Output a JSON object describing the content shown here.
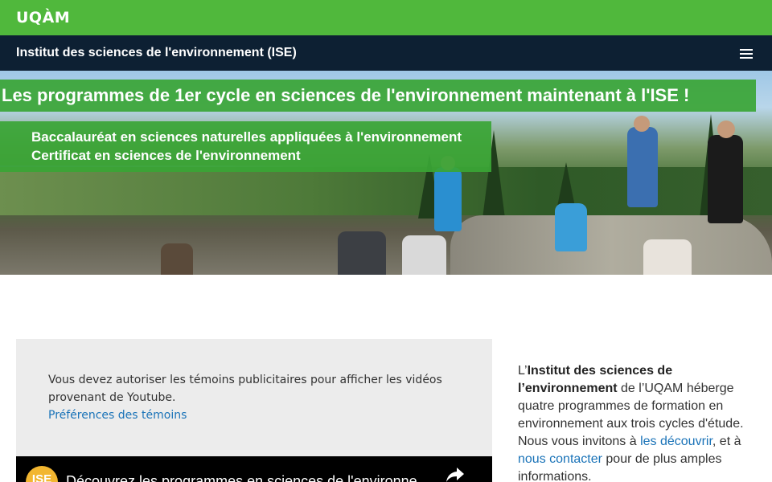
{
  "brand": {
    "logo_text": "UQÀM",
    "primary_color": "#50b83c",
    "dark_color": "#0d2033",
    "link_color": "#1a73b8"
  },
  "site": {
    "title": "Institut des sciences de l'environnement (ISE)",
    "menu_icon": "hamburger-menu-icon"
  },
  "hero": {
    "headline": "Les programmes de 1er cycle en sciences de l'environnement maintenant à l'ISE !",
    "program_1": "Baccalauréat en sciences naturelles appliquées à l'environnement",
    "program_2": "Certificat en sciences de l'environnement"
  },
  "video": {
    "consent_message": "Vous devez autoriser les témoins publicitaires pour afficher les vidéos provenant de Youtube.",
    "consent_link": "Préférences des témoins",
    "channel_avatar_text": "ISE",
    "video_title": "Découvrez les programmes en sciences de l'environne",
    "share_icon": "share-arrow-icon"
  },
  "intro": {
    "prefix": "L’",
    "institute_name": "Institut des sciences de l’environnement",
    "text_1": " de l’UQAM héberge quatre programmes de formation en environnement aux trois cycles d'étude. Nous vous invitons à ",
    "link_discover": "les découvrir",
    "text_2": ", et à ",
    "link_contact": "nous contacter",
    "text_3": " pour de plus amples informations."
  }
}
